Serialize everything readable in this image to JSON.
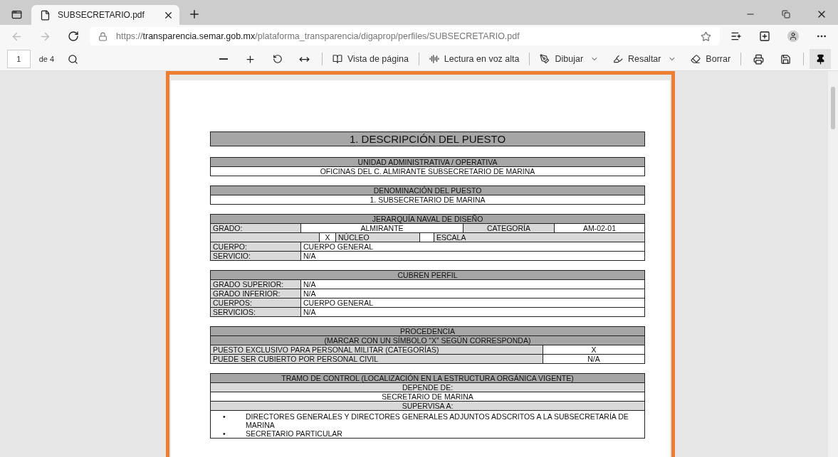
{
  "tabs": [
    {
      "title": "SUBSECRETARIO.pdf",
      "selected": true
    }
  ],
  "address": {
    "scheme": "https://",
    "host": "transparencia.semar.gob.mx",
    "path": "/plataforma_transparencia/digaprop/perfiles/SUBSECRETARIO.pdf"
  },
  "pdf_toolbar": {
    "page": "1",
    "page_count": "de 4",
    "tools": [
      {
        "kind": "view",
        "label": "Vista de página"
      },
      {
        "kind": "read",
        "label": "Lectura en voz alta"
      },
      {
        "kind": "draw",
        "label": "Dibujar"
      },
      {
        "kind": "highlight",
        "label": "Resaltar"
      },
      {
        "kind": "erase",
        "label": "Borrar"
      }
    ],
    "pinned": true
  },
  "document": {
    "title": "1. DESCRIPCIÓN DEL PUESTO",
    "sections": [
      {
        "kind": "simple",
        "header": "UNIDAD ADMINISTRATIVA / OPERATIVA",
        "value": "OFICINAS DEL C. ALMIRANTE SUBSECRETARIO DE MARINA"
      },
      {
        "kind": "simple",
        "header": "DENOMINACIÓN DEL PUESTO",
        "value": "1. SUBSECRETARIO DE MARINA"
      },
      {
        "kind": "rank",
        "header": "JERARQUÍA NAVAL DE DISEÑO",
        "grade_label": "GRADO:",
        "grade": "ALMIRANTE",
        "category_label": "CATEGORÍA",
        "category": "AM-02-01",
        "core_mark": "X",
        "core_label": "NÚCLEO",
        "scale_label": "ESCALA",
        "rows": [
          {
            "label": "CUERPO:",
            "value": "CUERPO GENERAL"
          },
          {
            "label": "SERVICIO:",
            "value": "N/A"
          }
        ]
      },
      {
        "kind": "fields",
        "header": "CUBREN PERFIL",
        "rows": [
          {
            "label": "GRADO SUPERIOR:",
            "value": "N/A"
          },
          {
            "label": "GRADO INFERIOR:",
            "value": "N/A"
          },
          {
            "label": "CUERPOS:",
            "value": "CUERPO GENERAL"
          },
          {
            "label": "SERVICIOS:",
            "value": "N/A"
          }
        ]
      },
      {
        "kind": "choices",
        "header_lines": [
          "PROCEDENCIA",
          "(MARCAR CON UN SÍMBOLO “X” SEGÚN CORRESPONDA)"
        ],
        "rows": [
          {
            "label": "PUESTO EXCLUSIVO PARA PERSONAL MILITAR (CATEGORÍAS)",
            "value": "X"
          },
          {
            "label": "PUEDE SER CUBIERTO POR PERSONAL CIVIL",
            "value": "N/A"
          }
        ]
      },
      {
        "kind": "control",
        "header": "TRAMO DE CONTROL (LOCALIZACIÓN EN LA ESTRUCTURA ORGÁNICA VIGENTE)",
        "depends_label": "DEPENDE DE:",
        "depends": "SECRETARIO DE MARINA",
        "supervises_label": "SUPERVISA A:",
        "supervises": [
          {
            "bullet": "•",
            "text": "DIRECTORES GENERALES Y DIRECTORES GENERALES ADJUNTOS ADSCRITOS A LA SUBSECRETARÍA DE MARINA"
          },
          {
            "bullet": "•",
            "text": "SECRETARIO PARTICULAR"
          }
        ]
      }
    ]
  }
}
